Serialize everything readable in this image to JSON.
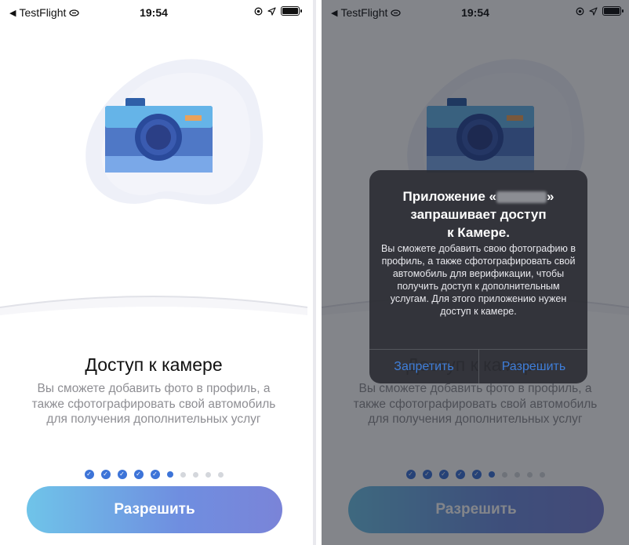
{
  "status_bar": {
    "back_app": "TestFlight",
    "time": "19:54"
  },
  "onboarding": {
    "title": "Доступ к камере",
    "description": "Вы сможете добавить фото в профиль, а также сфотографировать свой автомобиль для получения дополнительных услуг",
    "cta_label": "Разрешить",
    "steps_total": 9,
    "steps_completed": 5,
    "current_step": 6
  },
  "permission_alert": {
    "title_prefix": "Приложение «",
    "title_suffix": "»",
    "title_line2": "запрашивает доступ",
    "title_line3": "к Камере.",
    "message": "Вы сможете добавить свою фотографию в профиль, а также сфотографировать свой автомобиль для верификации, чтобы получить доступ к дополнительным услугам. Для этого приложению нужен доступ к камере.",
    "deny_label": "Запретить",
    "allow_label": "Разрешить"
  },
  "colors": {
    "accent": "#3d74d8",
    "alert_button": "#3f7ed9",
    "cta_gradient_start": "#6fc4e9",
    "cta_gradient_end": "#7a84d8"
  },
  "icons": [
    "back-arrow-icon",
    "link-icon",
    "location-icon",
    "navigation-arrow-icon",
    "battery-icon",
    "camera-icon",
    "check-icon"
  ]
}
